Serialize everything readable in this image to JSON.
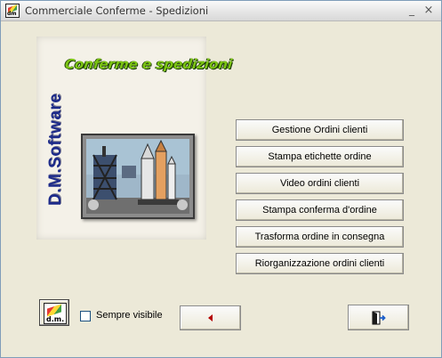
{
  "window": {
    "title": "Commerciale Conferme - Spedizioni",
    "minimize_glyph": "_",
    "close_glyph": "×"
  },
  "splash": {
    "title": "Conferme e spedizioni",
    "company": "D.M.Software",
    "image_icon": "space-shuttle-launch-icon"
  },
  "menu": {
    "buttons": [
      "Gestione Ordini clienti",
      "Stampa etichette ordine",
      "Video ordini clienti",
      "Stampa conferma d'ordine",
      "Trasforma ordine in consegna",
      "Riorganizzazione ordini clienti"
    ]
  },
  "footer": {
    "dm_logo_text": "d.m.",
    "always_visible_label": "Sempre visibile",
    "always_visible_checked": false,
    "back_icon": "triangle-left-icon",
    "exit_icon": "exit-door-icon"
  },
  "colors": {
    "back_arrow": "#b40000",
    "splash_title": "#7cc414",
    "company_text": "#1c2a8a"
  }
}
